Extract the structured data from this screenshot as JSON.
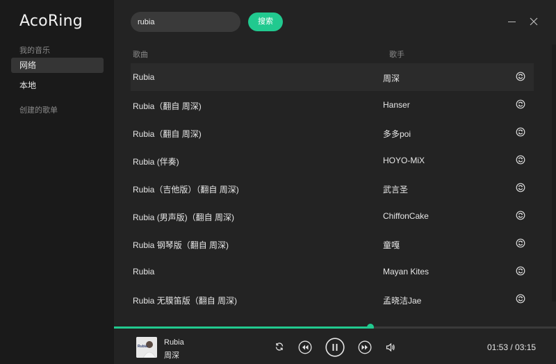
{
  "app": {
    "title": "AcoRing"
  },
  "sidebar": {
    "section_my_music": "我的音乐",
    "items": [
      {
        "label": "网络",
        "active": true
      },
      {
        "label": "本地",
        "active": false
      }
    ],
    "section_playlists": "创建的歌单"
  },
  "search": {
    "value": "rubia",
    "button_label": "搜索"
  },
  "table": {
    "col_song": "歌曲",
    "col_artist": "歌手",
    "rows": [
      {
        "title": "Rubia",
        "artist": "周深"
      },
      {
        "title": "Rubia（翻自 周深)",
        "artist": "Hanser"
      },
      {
        "title": "Rubia（翻自 周深)",
        "artist": "多多poi"
      },
      {
        "title": "Rubia (伴奏)",
        "artist": "HOYO-MiX"
      },
      {
        "title": "Rubia（吉他版）（翻自 周深)",
        "artist": "武言圣"
      },
      {
        "title": "Rubia (男声版)（翻自 周深)",
        "artist": "ChiffonCake"
      },
      {
        "title": "Rubia 钢琴版（翻自 周深)",
        "artist": "童嘎"
      },
      {
        "title": "Rubia",
        "artist": "Mayan Kites"
      },
      {
        "title": "Rubia 无膜笛版（翻自 周深)",
        "artist": "孟晓洁Jae"
      }
    ]
  },
  "player": {
    "song": "Rubia",
    "artist": "周深",
    "cover_text": "Rubia",
    "elapsed": "01:53",
    "total": "03:15",
    "time_display": "01:53 / 03:15",
    "progress": 0.58
  },
  "colors": {
    "accent": "#21c98f",
    "sidebar_bg": "#1a1a1a",
    "main_bg": "#232323"
  }
}
